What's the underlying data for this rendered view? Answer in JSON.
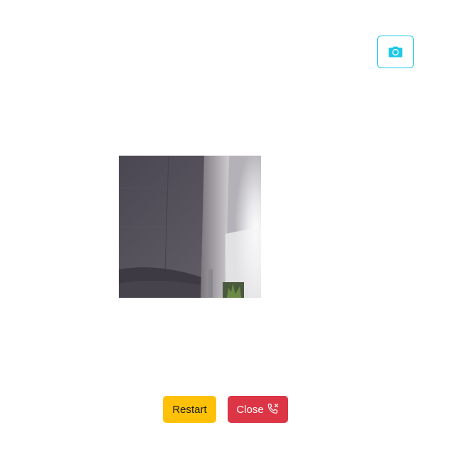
{
  "toolbar": {
    "snapshot_icon": "camera-icon",
    "accent_color": "#1ec8e6"
  },
  "video": {
    "feed_icon": "webcam-feed"
  },
  "controls": {
    "restart_label": "Restart",
    "restart_color": "#ffc107",
    "close_label": "Close",
    "close_icon": "phone-hangup-icon",
    "close_color": "#dc3545"
  }
}
